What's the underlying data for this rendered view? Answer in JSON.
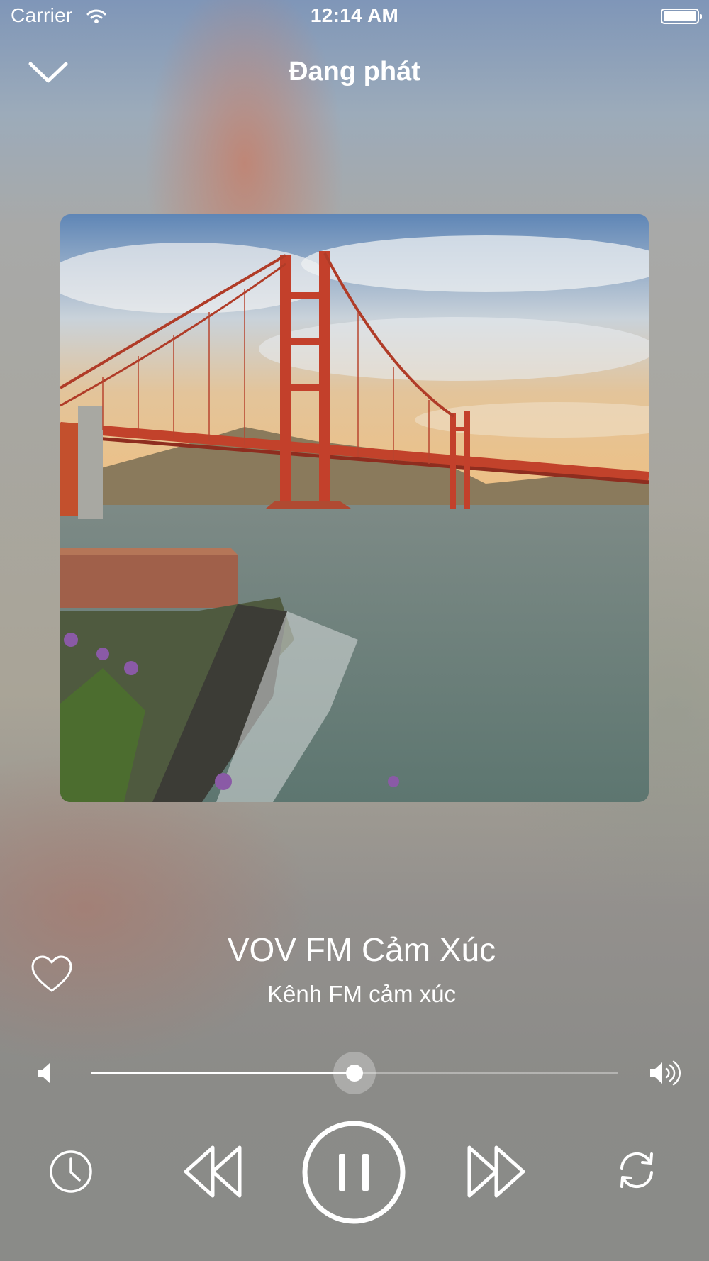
{
  "status_bar": {
    "carrier": "Carrier",
    "time": "12:14 AM"
  },
  "header": {
    "title": "Đang phát"
  },
  "now_playing": {
    "station": "VOV FM Cảm Xúc",
    "subtitle": "Kênh FM cảm xúc",
    "favorite": false,
    "is_playing": true
  },
  "volume": {
    "level": 0.5
  },
  "icons": {
    "collapse": "chevron-down-icon",
    "favorite": "heart-outline-icon",
    "volume_low": "speaker-low-icon",
    "volume_high": "speaker-high-icon",
    "timer": "clock-icon",
    "previous": "rewind-icon",
    "play_state": "pause-icon",
    "next": "fast-forward-icon",
    "repeat": "repeat-icon"
  },
  "colors": {
    "foreground": "#ffffff"
  }
}
